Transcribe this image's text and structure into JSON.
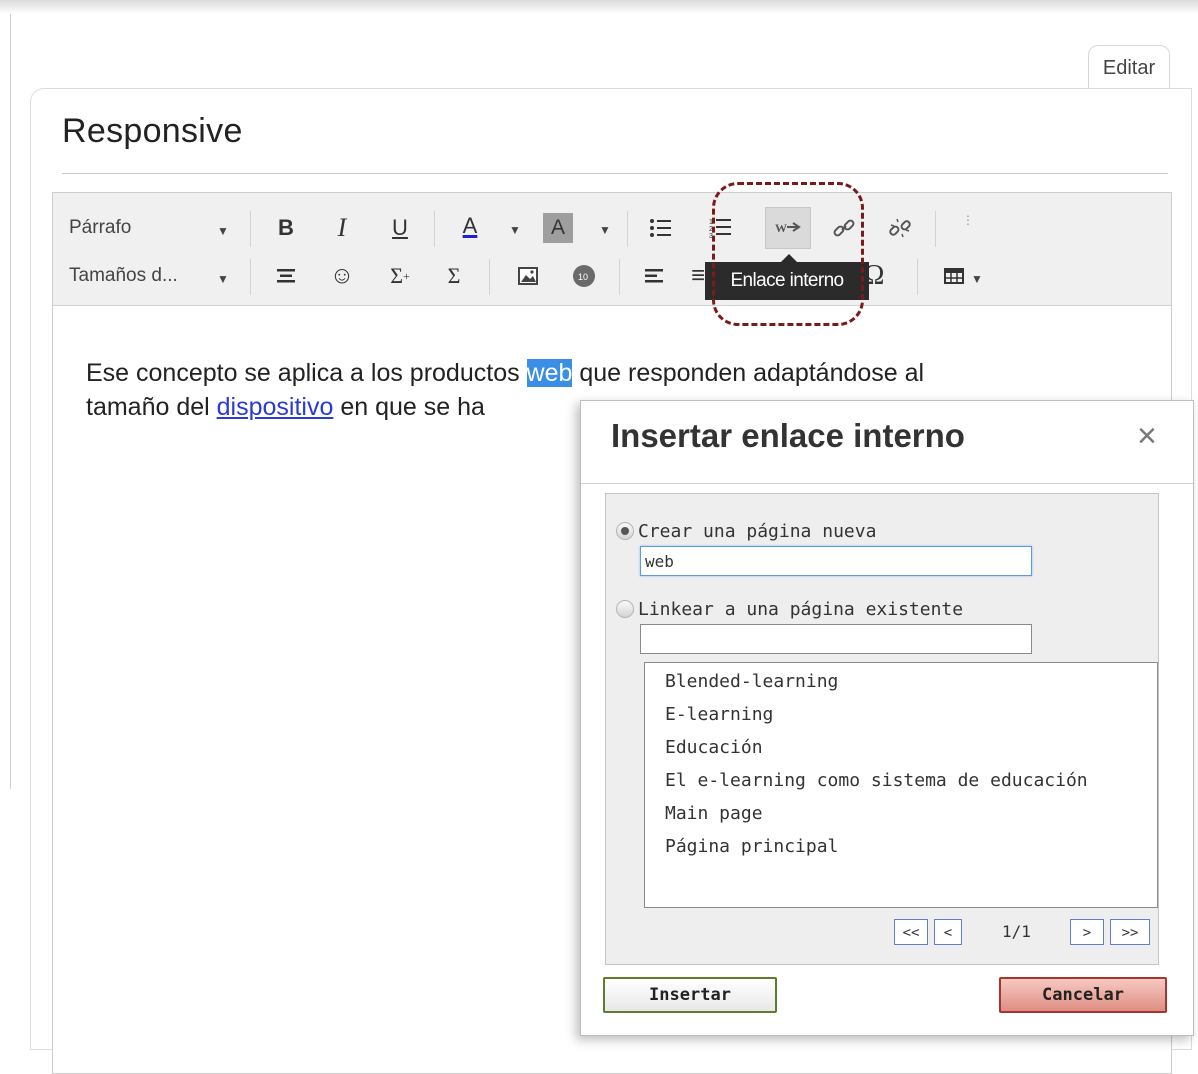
{
  "page": {
    "edit_tab": "Editar",
    "title": "Responsive"
  },
  "toolbar": {
    "format_select": "Párrafo",
    "size_select": "Tamaños d...",
    "bold": "B",
    "italic": "I",
    "underline": "U",
    "font_color": "A",
    "bg_color": "A",
    "tooltip": "Enlace interno"
  },
  "content": {
    "part1": "Ese concepto se aplica a los productos ",
    "selected": "web",
    "part2": " que responden adaptándose al",
    "part3": "tamaño del ",
    "link": "dispositivo",
    "part4": " en que se ha"
  },
  "dialog": {
    "title": "Insertar enlace interno",
    "close": "×",
    "new_page_label": "Crear una página nueva",
    "new_page_value": "web",
    "existing_label": "Linkear a una página existente",
    "existing_value": "",
    "pages": [
      "Blended-learning",
      "E-learning",
      "Educación",
      "El e-learning como sistema de educación",
      "Main page",
      "Página principal"
    ],
    "pager": {
      "first": "<<",
      "prev": "<",
      "status": "1/1",
      "next": ">",
      "last": ">>"
    },
    "insert": "Insertar",
    "cancel": "Cancelar"
  },
  "colors": {
    "selection": "#3b8ee6",
    "link": "#2a3bd1",
    "callout": "#7b1a1a",
    "insert_border": "#5e7c2c",
    "cancel_bg": "#df8e83"
  }
}
